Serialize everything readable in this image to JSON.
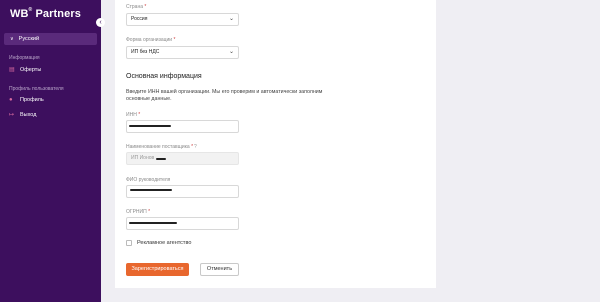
{
  "sidebar": {
    "logo_main": "WB",
    "logo_sup": "®",
    "logo_sub": "Partners",
    "collapse_icon": "‹",
    "language": "Русский",
    "section_info": "Информация",
    "offers": "Оферты",
    "section_profile": "Профиль пользователя",
    "profile": "Профиль",
    "logout": "Выход"
  },
  "form": {
    "country_label": "Страна",
    "country_value": "Россия",
    "org_form_label": "Форма организации",
    "org_form_value": "ИП без НДС",
    "required_mark": "*",
    "section_heading": "Основная информация",
    "description": "Введите ИНН вашей организации. Мы его проверим и автоматически заполним основные данные.",
    "inn_label": "ИНН",
    "supplier_name_label": "Наименование поставщика",
    "supplier_name_value": "ИП Ионов",
    "help_mark": "?",
    "director_label": "ФИО руководителя",
    "ogrnip_label": "ОГРНИП",
    "ad_agency_label": "Рекламное агентство",
    "submit_label": "Зарегистрироваться",
    "cancel_label": "Отменить"
  }
}
